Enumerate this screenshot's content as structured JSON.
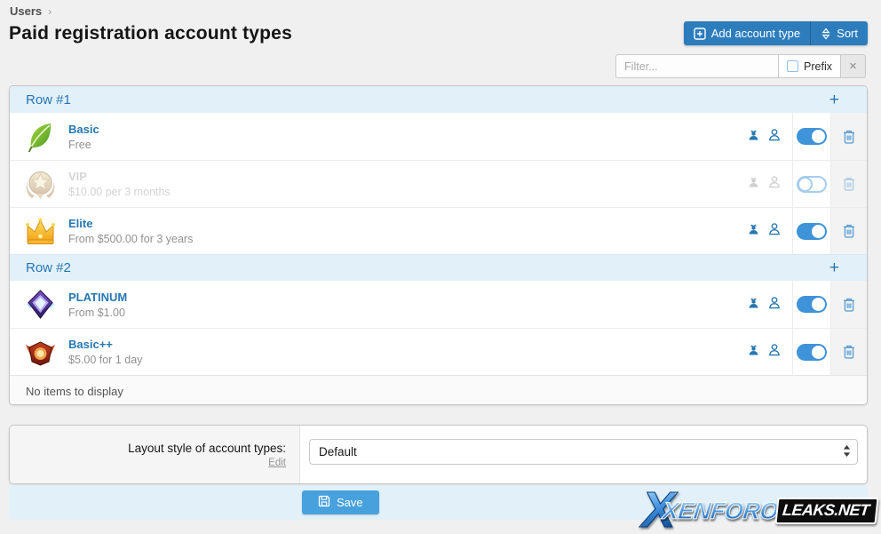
{
  "colors": {
    "accent": "#2577b1",
    "toolbar_button_blue": "#2d7dbd",
    "save_button_blue": "#47a1dd",
    "section_header_bg": "#e2f0fa",
    "page_bg": "#f0f0f0",
    "toggle_on": "#3e93d9"
  },
  "breadcrumb": {
    "root": "Users",
    "separator": "›"
  },
  "page_title": "Paid registration account types",
  "toolbar": {
    "add_button": "Add account type",
    "sort_button": "Sort"
  },
  "filter_bar": {
    "placeholder": "Filter...",
    "prefix_label": "Prefix",
    "clear_label": "×"
  },
  "account_list": {
    "sections": [
      {
        "label": "Row #1",
        "add_label": "+",
        "items": [
          {
            "title": "Basic",
            "subtitle": "Free",
            "icon": "green-leaf-icon",
            "enabled": true
          },
          {
            "title": "VIP",
            "subtitle": "$10.00 per 3 months",
            "icon": "gold-badge-icon",
            "enabled": false
          },
          {
            "title": "Elite",
            "subtitle": "From $500.00 for 3 years",
            "icon": "gold-crown-icon",
            "enabled": true
          }
        ]
      },
      {
        "label": "Row #2",
        "add_label": "+",
        "items": [
          {
            "title": "PLATINUM",
            "subtitle": "From $1.00",
            "icon": "platinum-diamond-icon",
            "enabled": true
          },
          {
            "title": "Basic++",
            "subtitle": "$5.00 for 1 day",
            "icon": "red-winged-badge-icon",
            "enabled": true
          }
        ]
      }
    ],
    "empty_text": "No items to display"
  },
  "layout_form": {
    "label": "Layout style of account types:",
    "edit_link": "Edit",
    "select_value": "Default"
  },
  "submit_bar": {
    "save_button": "Save"
  },
  "watermark": {
    "x": "X",
    "brand": "XENFORO",
    "suffix": "LEAKS.NET"
  }
}
